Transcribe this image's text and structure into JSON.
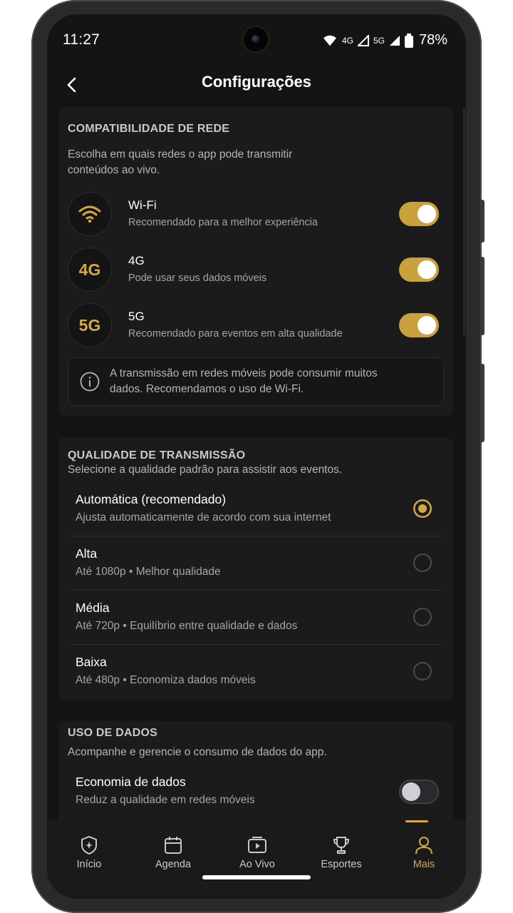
{
  "status": {
    "time": "11:27",
    "net1": "4G",
    "net2": "5G",
    "battery": "78%"
  },
  "header": {
    "title": "Configurações"
  },
  "network": {
    "title": "COMPATIBILIDADE DE REDE",
    "description": "Escolha em quais redes o app pode transmitir conteúdos ao vivo.",
    "items": [
      {
        "title": "Wi-Fi",
        "subtitle": "Recomendado para a melhor experiência",
        "badge": "",
        "enabled": true
      },
      {
        "title": "4G",
        "subtitle": "Pode usar seus dados móveis",
        "badge": "4G",
        "enabled": true
      },
      {
        "title": "5G",
        "subtitle": "Recomendado para eventos em alta qualidade",
        "badge": "5G",
        "enabled": true
      }
    ],
    "note": "A transmissão em redes móveis pode consumir muitos dados. Recomendamos o uso de Wi-Fi."
  },
  "quality": {
    "title": "QUALIDADE DE TRANSMISSÃO",
    "description": "Selecione a qualidade padrão para assistir aos eventos.",
    "options": [
      {
        "title": "Automática (recomendado)",
        "subtitle": "Ajusta automaticamente de acordo com sua internet",
        "selected": true
      },
      {
        "title": "Alta",
        "subtitle": "Até 1080p • Melhor qualidade",
        "selected": false
      },
      {
        "title": "Média",
        "subtitle": "Até 720p • Equilíbrio entre qualidade e dados",
        "selected": false
      },
      {
        "title": "Baixa",
        "subtitle": "Até 480p • Economiza dados móveis",
        "selected": false
      }
    ]
  },
  "data_usage": {
    "title": "USO DE DADOS",
    "description": "Acompanhe e gerencie o consumo de dados do app.",
    "economy": {
      "title": "Economia de dados",
      "subtitle": "Reduz a qualidade em redes móveis",
      "enabled": false
    }
  },
  "nav": {
    "items": [
      {
        "label": "Início",
        "icon": "shield-icon",
        "active": false
      },
      {
        "label": "Agenda",
        "icon": "calendar-icon",
        "active": false
      },
      {
        "label": "Ao Vivo",
        "icon": "play-icon",
        "active": false
      },
      {
        "label": "Esportes",
        "icon": "trophy-icon",
        "active": false
      },
      {
        "label": "Mais",
        "icon": "user-icon",
        "active": true
      }
    ]
  },
  "colors": {
    "accent": "#d4a843",
    "background": "#141414",
    "card": "#1b1b1c"
  }
}
